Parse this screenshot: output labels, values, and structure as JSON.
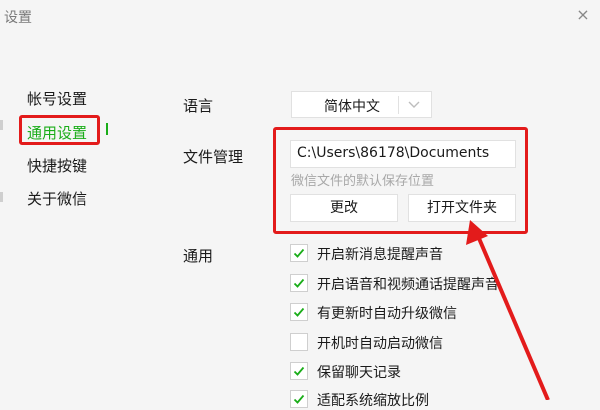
{
  "window": {
    "title": "设置",
    "close_glyph": "×"
  },
  "sidebar": {
    "items": [
      {
        "label": "帐号设置",
        "active": false
      },
      {
        "label": "通用设置",
        "active": true
      },
      {
        "label": "快捷按键",
        "active": false
      },
      {
        "label": "关于微信",
        "active": false
      }
    ]
  },
  "language": {
    "label": "语言",
    "value": "简体中文"
  },
  "file_management": {
    "label": "文件管理",
    "path": "C:\\Users\\86178\\Documents",
    "hint": "微信文件的默认保存位置",
    "change_button": "更改",
    "open_folder_button": "打开文件夹"
  },
  "general": {
    "label": "通用",
    "options": [
      {
        "label": "开启新消息提醒声音",
        "checked": true
      },
      {
        "label": "开启语音和视频通话提醒声音",
        "checked": true
      },
      {
        "label": "有更新时自动升级微信",
        "checked": true
      },
      {
        "label": "开机时自动启动微信",
        "checked": false
      },
      {
        "label": "保留聊天记录",
        "checked": true
      },
      {
        "label": "适配系统缩放比例",
        "checked": true
      }
    ]
  },
  "colors": {
    "accent": "#1aad19",
    "annotation": "#e31b1b",
    "background": "#f5f5f5"
  },
  "icons": {
    "close": "close-icon",
    "dropdown": "chevron-down-icon",
    "check": "check-icon"
  }
}
